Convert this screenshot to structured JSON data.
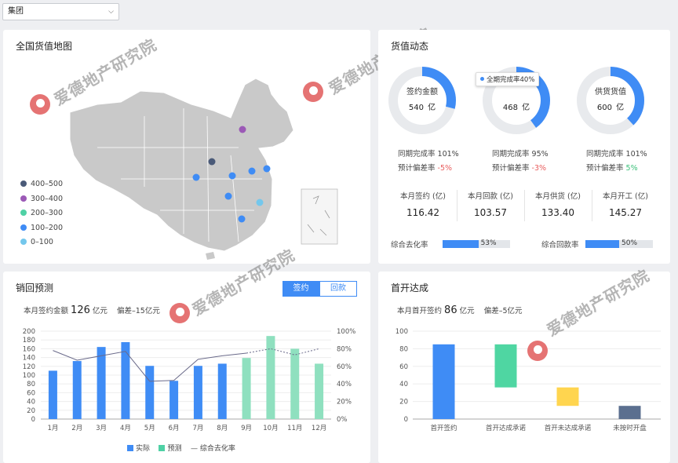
{
  "filter": {
    "selected": "集团"
  },
  "map_card": {
    "title": "全国货值地图",
    "legend": [
      {
        "label": "400–500",
        "color": "#4a5a78"
      },
      {
        "label": "300–400",
        "color": "#9b59b6"
      },
      {
        "label": "200–300",
        "color": "#4fd1a5"
      },
      {
        "label": "100–200",
        "color": "#3f8cf5"
      },
      {
        "label": "0–100",
        "color": "#74c7ec"
      }
    ]
  },
  "value_card": {
    "title": "货值动态",
    "tooltip": "全期完成率40%",
    "donuts": [
      {
        "label": "签约金额",
        "value": "540",
        "unit": "亿",
        "rate_label": "同期完成率",
        "rate": "101%",
        "dev_label": "预计偏差率",
        "dev": "-5%",
        "progress": 0.29
      },
      {
        "label": "回款金额",
        "value": "468",
        "unit": "亿",
        "rate_label": "同期完成率",
        "rate": "95%",
        "dev_label": "预计偏差率",
        "dev": "-3%",
        "progress": 0.4
      },
      {
        "label": "供货货值",
        "value": "600",
        "unit": "亿",
        "rate_label": "同期完成率",
        "rate": "101%",
        "dev_label": "预计偏差率",
        "dev": "5%",
        "progress": 0.38
      }
    ],
    "month_stats": [
      {
        "label": "本月签约 (亿)",
        "value": "116.42"
      },
      {
        "label": "本月回款 (亿)",
        "value": "103.57"
      },
      {
        "label": "本月供货 (亿)",
        "value": "133.40"
      },
      {
        "label": "本月开工 (亿)",
        "value": "145.27"
      }
    ],
    "bars": [
      {
        "label": "综合去化率",
        "value": "53%",
        "fraction": 0.53
      },
      {
        "label": "综合回款率",
        "value": "50%",
        "fraction": 0.5
      }
    ]
  },
  "sales_card": {
    "title": "销回预测",
    "tabs": [
      "签约",
      "回款"
    ],
    "summary_label": "本月签约金额",
    "summary_value": "126",
    "summary_unit": "亿元",
    "deviation": "偏差–15亿元",
    "legend": [
      "实际",
      "预测",
      "综合去化率"
    ]
  },
  "opening_card": {
    "title": "首开达成",
    "summary_label": "本月首开签约",
    "summary_value": "86",
    "summary_unit": "亿元",
    "deviation": "偏差–5亿元"
  },
  "watermark": {
    "text": "爱德地产研究院"
  },
  "colors": {
    "actual": "#3f8cf5",
    "forecast": "#8fe0bf",
    "line": "#6a6a8a",
    "accent": "#3f8cf5"
  },
  "chart_data": [
    {
      "type": "bar",
      "categories": [
        "1月",
        "2月",
        "3月",
        "4月",
        "5月",
        "6月",
        "7月",
        "8月",
        "9月",
        "10月",
        "11月",
        "12月"
      ],
      "series": [
        {
          "name": "实际",
          "values": [
            110,
            132,
            164,
            175,
            121,
            87,
            121,
            126,
            null,
            null,
            null,
            null
          ]
        },
        {
          "name": "预测",
          "values": [
            null,
            null,
            null,
            null,
            null,
            null,
            null,
            null,
            139,
            189,
            160,
            126
          ]
        },
        {
          "name": "综合去化率",
          "type": "line",
          "axis": "right",
          "values": [
            78,
            67,
            72,
            77,
            43,
            44,
            68,
            72,
            75,
            80,
            73,
            80
          ]
        }
      ],
      "yticks": [
        0,
        20,
        40,
        60,
        80,
        100,
        120,
        140,
        160,
        180,
        200
      ],
      "ylim": [
        0,
        200
      ],
      "y2ticks": [
        "0%",
        "20%",
        "40%",
        "60%",
        "80%",
        "100%"
      ],
      "y2lim": [
        0,
        100
      ]
    },
    {
      "type": "bar",
      "categories": [
        "首开签约",
        "首开达成承诺",
        "首开未达成承诺",
        "未按时开盘"
      ],
      "bars": [
        {
          "low": 0,
          "high": 85,
          "color": "#3f8cf5"
        },
        {
          "low": 36,
          "high": 85,
          "color": "#4fd6a2"
        },
        {
          "low": 15,
          "high": 36,
          "color": "#ffd54f"
        },
        {
          "low": 0,
          "high": 15,
          "color": "#5b6f8f"
        }
      ],
      "yticks": [
        0,
        20,
        40,
        60,
        80,
        100
      ],
      "ylim": [
        0,
        100
      ]
    }
  ]
}
